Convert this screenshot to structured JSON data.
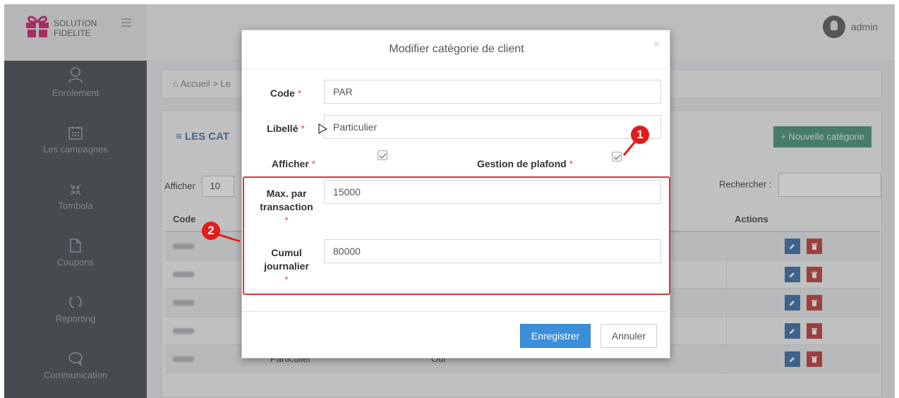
{
  "header": {
    "brand_line1": "SOLUTION",
    "brand_line2": "FIDELITE",
    "user_name": "admin"
  },
  "sidebar": {
    "items": [
      {
        "label": "Enrolement",
        "icon": "user-icon"
      },
      {
        "label": "Les campagnes",
        "icon": "calendar-icon"
      },
      {
        "label": "Tombola",
        "icon": "compress-arrows-icon"
      },
      {
        "label": "Coupons",
        "icon": "document-icon"
      },
      {
        "label": "Reporting",
        "icon": "refresh-icon"
      },
      {
        "label": "Communication",
        "icon": "chat-bubble-icon"
      }
    ]
  },
  "breadcrumb": {
    "home": "Accueil",
    "separator": ">",
    "current": "Le"
  },
  "panel": {
    "title": "LES CAT",
    "new_button": "Nouvelle catégorie",
    "show_label": "Afficher",
    "show_value": "10",
    "search_label": "Rechercher :",
    "columns": {
      "code": "Code",
      "actions": "Actions"
    },
    "rows": [
      {
        "libelle": "",
        "afficher": ""
      },
      {
        "libelle": "",
        "afficher": ""
      },
      {
        "libelle": "",
        "afficher": ""
      },
      {
        "libelle": "",
        "afficher": ""
      },
      {
        "libelle": "Particulier",
        "afficher": "Oui"
      }
    ]
  },
  "modal": {
    "title": "Modifier catégorie de client",
    "close": "×",
    "required_mark": "*",
    "code_label": "Code",
    "code_value": "PAR",
    "libelle_label": "Libellé",
    "libelle_value": "Particulier",
    "afficher_label": "Afficher",
    "afficher_checked": true,
    "plafond_label": "Gestion de plafond",
    "plafond_checked": true,
    "max_label_1": "Max. par",
    "max_label_2": "transaction",
    "max_value": "15000",
    "cumul_label_1": "Cumul",
    "cumul_label_2": "journalier",
    "cumul_value": "80000",
    "save_button": "Enregistrer",
    "cancel_button": "Annuler"
  },
  "annotations": {
    "badge_1": "1",
    "badge_2": "2",
    "color": "#e31b1b"
  }
}
